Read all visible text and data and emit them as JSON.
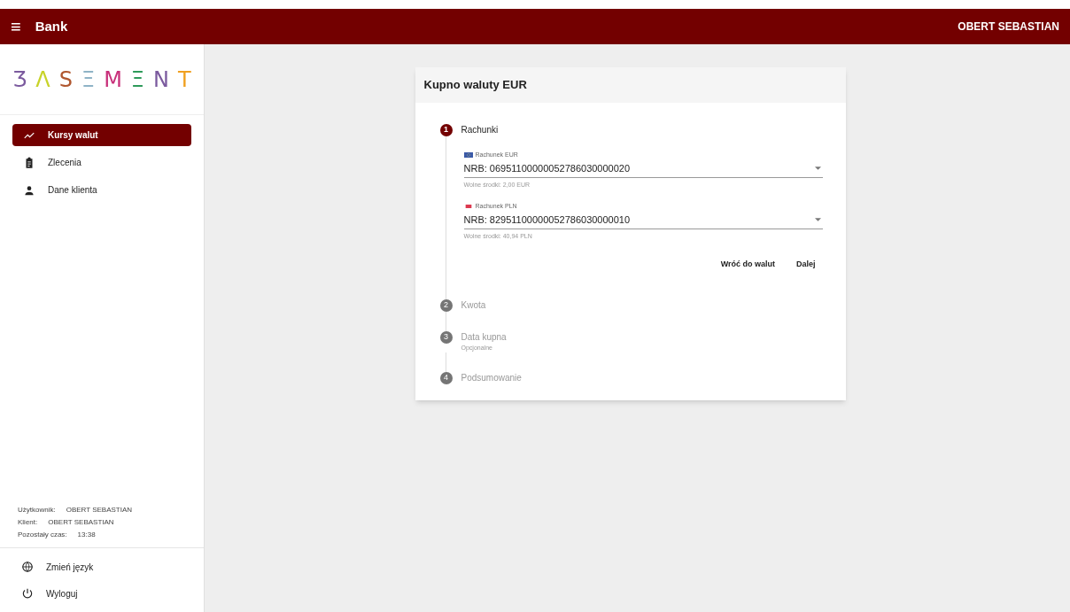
{
  "app_bar": {
    "menu_icon": "≡",
    "title": "Bank",
    "user": "OBERT SEBASTIAN"
  },
  "logo": [
    {
      "char": "Ʒ",
      "color": "#7b5a9e"
    },
    {
      "char": "Λ",
      "color": "#c8d32a"
    },
    {
      "char": "S",
      "color": "#b0572f"
    },
    {
      "char": "Ξ",
      "color": "#8fb3c6"
    },
    {
      "char": "M",
      "color": "#c8307a"
    },
    {
      "char": "Ξ",
      "color": "#2e9a5a"
    },
    {
      "char": "N",
      "color": "#7b5a9e"
    },
    {
      "char": "T",
      "color": "#f0a020"
    }
  ],
  "sidebar": {
    "items": [
      {
        "label": "Kursy walut",
        "selected": true
      },
      {
        "label": "Zlecenia",
        "selected": false
      },
      {
        "label": "Dane klienta",
        "selected": false
      }
    ],
    "info": [
      {
        "label": "Użytkownik:",
        "value": "OBERT SEBASTIAN"
      },
      {
        "label": "Klient:",
        "value": "OBERT SEBASTIAN"
      },
      {
        "label": "Pozostały czas:",
        "value": "13:38"
      }
    ],
    "bottom_items": [
      {
        "label": "Zmień język"
      },
      {
        "label": "Wyloguj"
      }
    ]
  },
  "card": {
    "title": "Kupno waluty EUR",
    "steps": [
      {
        "number": "1",
        "label": "Rachunki",
        "selected": true
      },
      {
        "number": "2",
        "label": "Kwota",
        "selected": false
      },
      {
        "number": "3",
        "label": "Data kupna",
        "subtitle": "Opcjonalne",
        "selected": false
      },
      {
        "number": "4",
        "label": "Podsumowanie",
        "selected": false
      }
    ],
    "fields": [
      {
        "label": "Rachunek EUR",
        "value": "NRB: 06951100000052786030000020",
        "hint": "Wolne środki: 2,00 EUR"
      },
      {
        "label": "Rachunek PLN",
        "value": "NRB: 82951100000052786030000010",
        "hint": "Wolne środki: 40,94 PLN"
      }
    ],
    "buttons": [
      "Wróć do walut",
      "Dalej"
    ]
  }
}
